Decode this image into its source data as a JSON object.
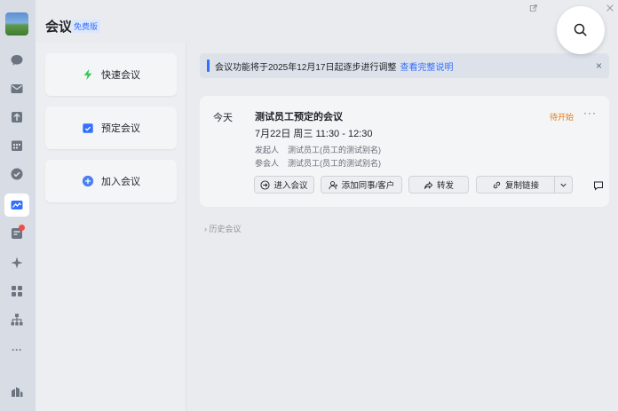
{
  "header": {
    "title": "会议",
    "badge": "免费版"
  },
  "sidebar": {
    "items": [
      {
        "icon": "chat-icon"
      },
      {
        "icon": "mail-icon"
      },
      {
        "icon": "upload-icon"
      },
      {
        "icon": "calendar-icon"
      },
      {
        "icon": "check-icon"
      },
      {
        "icon": "meeting-icon",
        "active": true
      },
      {
        "icon": "approval-icon",
        "dot": true
      },
      {
        "icon": "sparkle-icon"
      },
      {
        "icon": "apps-icon"
      },
      {
        "icon": "org-icon"
      },
      {
        "icon": "more-icon",
        "label": "···"
      },
      {
        "icon": "workspace-icon"
      }
    ]
  },
  "actions": {
    "quick": "快速会议",
    "schedule": "预定会议",
    "join": "加入会议"
  },
  "notice": {
    "text": "会议功能将于2025年12月17日起逐步进行调整",
    "link": "查看完整说明",
    "close": "×"
  },
  "meeting": {
    "day": "今天",
    "title": "测试员工预定的会议",
    "status": "待开始",
    "more": "···",
    "time": "7月22日 周三 11:30 - 12:30",
    "organizer_label": "发起人",
    "organizer": "测试员工(员工的测试别名)",
    "participant_label": "参会人",
    "participant": "测试员工(员工的测试别名)",
    "buttons": {
      "enter": "进入会议",
      "add": "添加同事/客户",
      "forward": "转发",
      "copy": "复制链接"
    }
  },
  "history": {
    "arrow": "›",
    "label": "历史会议"
  },
  "colors": {
    "accent": "#3370ff",
    "status": "#e07b1b",
    "rail": "#d8dde5"
  }
}
